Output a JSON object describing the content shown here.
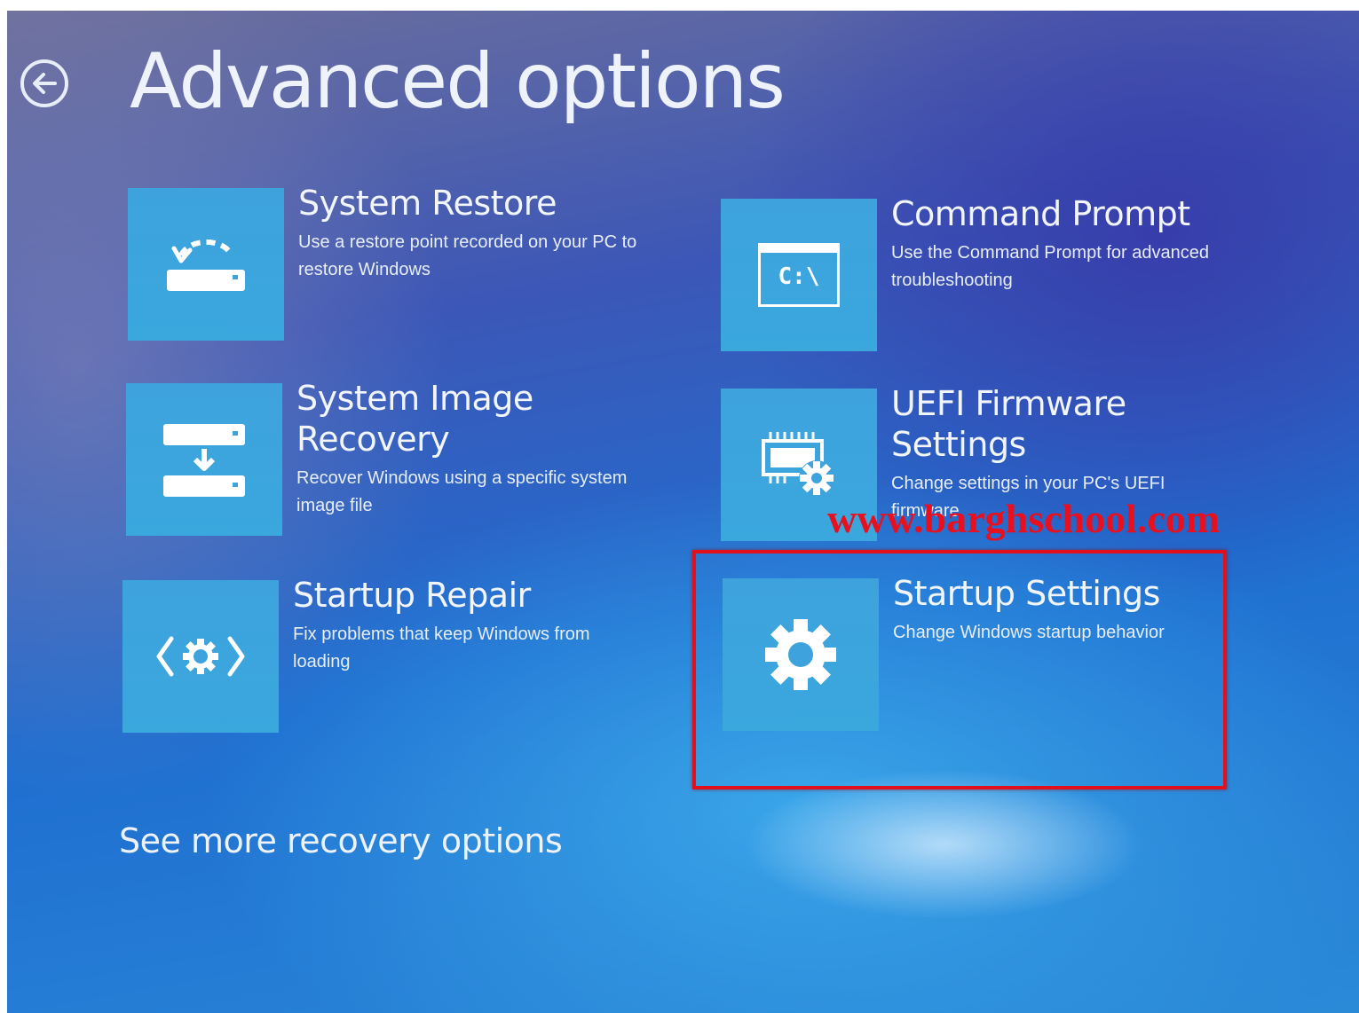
{
  "page": {
    "title": "Advanced options",
    "back_icon": "back-arrow-circle-icon"
  },
  "options": [
    {
      "id": "system-restore",
      "title": "System Restore",
      "description": "Use a restore point recorded on your PC to restore Windows",
      "icon": "system-restore-icon"
    },
    {
      "id": "command-prompt",
      "title": "Command Prompt",
      "description": "Use the Command Prompt for advanced troubleshooting",
      "icon": "command-prompt-icon",
      "icon_text": "C:\\"
    },
    {
      "id": "system-image-recovery",
      "title": "System Image Recovery",
      "description": "Recover Windows using a specific system image file",
      "icon": "system-image-recovery-icon"
    },
    {
      "id": "uefi-firmware-settings",
      "title": "UEFI Firmware Settings",
      "description": "Change settings in your PC's UEFI firmware",
      "icon": "uefi-firmware-icon"
    },
    {
      "id": "startup-repair",
      "title": "Startup Repair",
      "description": "Fix problems that keep Windows from loading",
      "icon": "startup-repair-icon"
    },
    {
      "id": "startup-settings",
      "title": "Startup Settings",
      "description": "Change Windows startup behavior",
      "icon": "gear-icon",
      "highlighted": true
    }
  ],
  "more_link": "See more recovery options",
  "watermark": "www.barghschool.com",
  "colors": {
    "tile": "#3ea3dd",
    "highlight": "#e0111c",
    "watermark": "#e8101e",
    "text": "#f2f6fc"
  }
}
